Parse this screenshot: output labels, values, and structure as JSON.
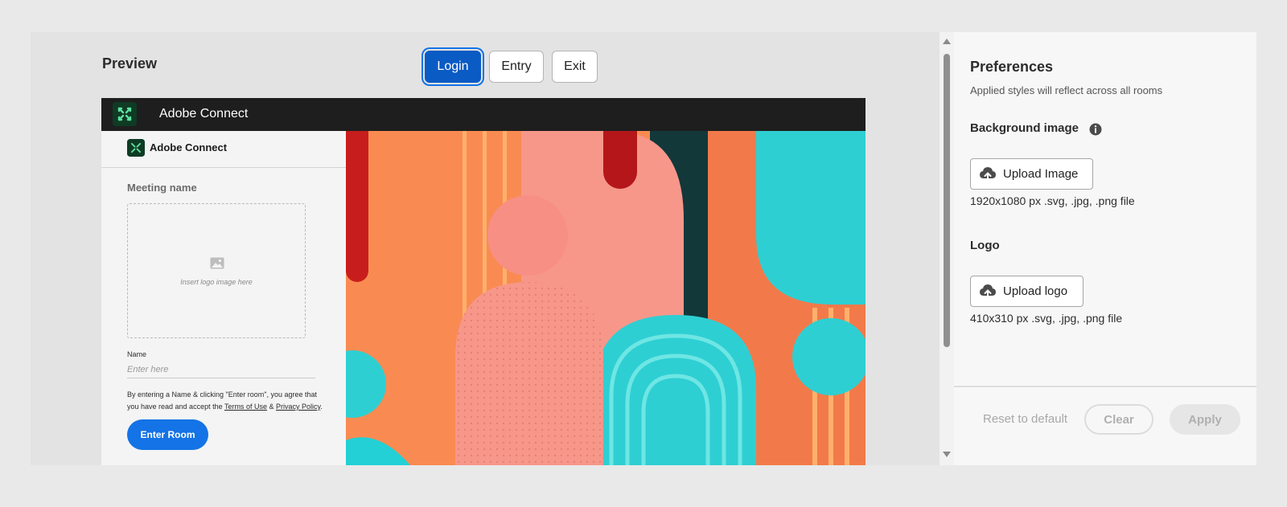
{
  "preview": {
    "title": "Preview",
    "tabs": [
      {
        "label": "Login",
        "active": true
      },
      {
        "label": "Entry",
        "active": false
      },
      {
        "label": "Exit",
        "active": false
      }
    ],
    "window": {
      "app_title": "Adobe Connect",
      "brand_title": "Adobe Connect",
      "meeting_label": "Meeting name",
      "logo_placeholder": "Insert logo image here",
      "name_label": "Name",
      "name_placeholder": "Enter here",
      "consent_text_1": "By entering a Name & clicking \"Enter room\", you agree that you have read and accept the ",
      "terms_link": "Terms of Use",
      "consent_amp": " & ",
      "privacy_link": "Privacy Policy",
      "consent_end": ".",
      "enter_button": "Enter Room"
    }
  },
  "preferences": {
    "title": "Preferences",
    "subtitle": "Applied styles will reflect across all rooms",
    "background": {
      "label": "Background image",
      "upload_button": "Upload Image",
      "spec": "1920x1080 px .svg, .jpg, .png file"
    },
    "logo": {
      "label": "Logo",
      "upload_button": "Upload logo",
      "spec": "410x310 px .svg, .jpg, .png file"
    },
    "footer": {
      "reset": "Reset to default",
      "clear": "Clear",
      "apply": "Apply"
    }
  },
  "colors": {
    "accent": "#1473e6",
    "active_tab": "#0a5bc4",
    "topbar": "#1e1e1e",
    "art_orange": "#f98b52",
    "art_coral": "#f7978a",
    "art_teal": "#2ecfd3",
    "art_red": "#c81d1d"
  }
}
